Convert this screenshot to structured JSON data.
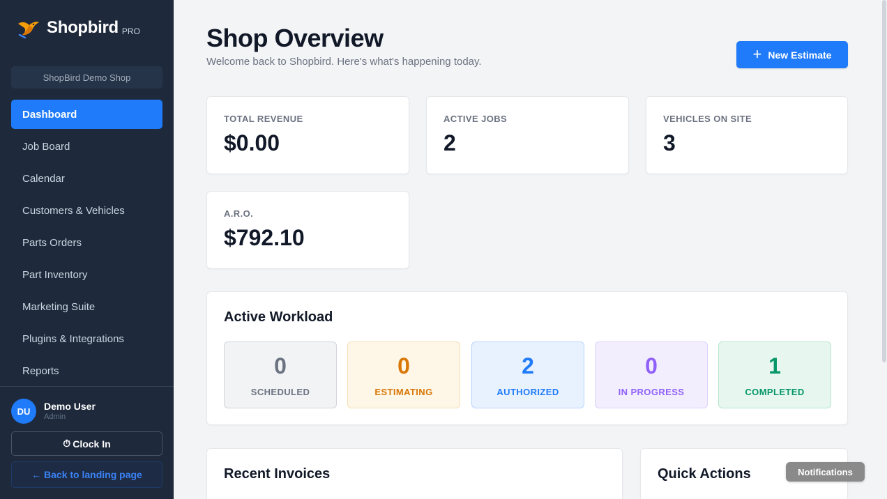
{
  "brand": {
    "name": "Shopbird",
    "tag": "PRO"
  },
  "shop_selector": {
    "value": "ShopBird Demo Shop"
  },
  "nav": {
    "items": [
      {
        "label": "Dashboard",
        "active": true
      },
      {
        "label": "Job Board"
      },
      {
        "label": "Calendar"
      },
      {
        "label": "Customers & Vehicles"
      },
      {
        "label": "Parts Orders"
      },
      {
        "label": "Part Inventory"
      },
      {
        "label": "Marketing Suite"
      },
      {
        "label": "Plugins & Integrations"
      },
      {
        "label": "Reports"
      }
    ]
  },
  "user": {
    "initials": "DU",
    "name": "Demo User",
    "role": "Admin"
  },
  "clock_in": {
    "icon": "⏱",
    "label": "Clock In"
  },
  "back_link": {
    "label": "← Back to landing page"
  },
  "header": {
    "title": "Shop Overview",
    "subtitle": "Welcome back to Shopbird. Here's what's happening today.",
    "new_button": {
      "icon": "+",
      "label": "New Estimate"
    }
  },
  "stats": [
    {
      "label": "TOTAL REVENUE",
      "value": "$0.00"
    },
    {
      "label": "ACTIVE JOBS",
      "value": "2"
    },
    {
      "label": "VEHICLES ON SITE",
      "value": "3"
    },
    {
      "label": "A.R.O.",
      "value": "$792.10"
    }
  ],
  "workload": {
    "title": "Active Workload",
    "items": [
      {
        "count": "0",
        "label": "SCHEDULED"
      },
      {
        "count": "0",
        "label": "ESTIMATING"
      },
      {
        "count": "2",
        "label": "AUTHORIZED"
      },
      {
        "count": "0",
        "label": "IN PROGRESS"
      },
      {
        "count": "1",
        "label": "COMPLETED"
      }
    ]
  },
  "recent_invoices": {
    "title": "Recent Invoices"
  },
  "quick_actions": {
    "title": "Quick Actions"
  },
  "notifications": {
    "label": "Notifications"
  },
  "colors": {
    "sidebar_bg": "#1e293b",
    "accent": "#1f7bf9",
    "scheduled": "#6b7280",
    "estimating": "#d97706",
    "authorized": "#1f7bf9",
    "in_progress": "#9061f9",
    "completed": "#059669"
  }
}
